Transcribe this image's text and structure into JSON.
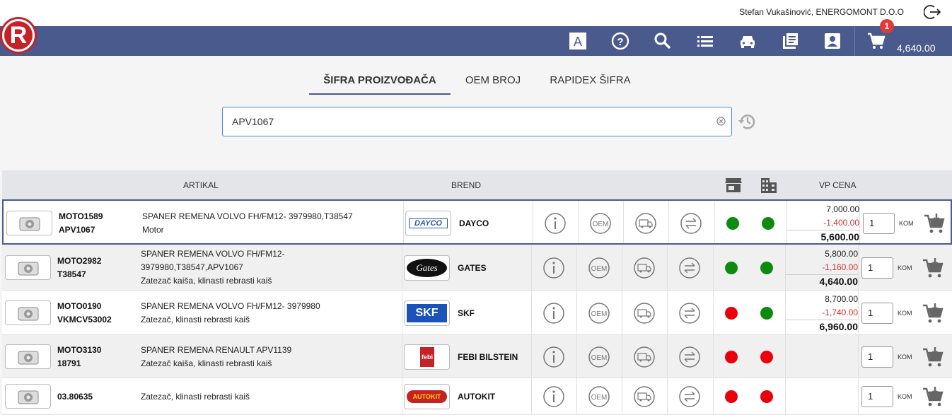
{
  "header": {
    "user": "Stefan Vukašinović, ENERGOMONT D.O.O",
    "cart_count": "1",
    "cart_total": "4,640.00",
    "logo_letter": "R"
  },
  "tabs": [
    "ŠIFRA PROIZVOĐAČA",
    "OEM BROJ",
    "RAPIDEX ŠIFRA"
  ],
  "search": {
    "value": "APV1067"
  },
  "columns": {
    "article": "ARTIKAL",
    "brand": "BREND",
    "price": "VP CENA"
  },
  "unit_label": "KOM",
  "rows": [
    {
      "code1": "MOTO1589",
      "code2": "APV1067",
      "desc1": "SPANER REMENA VOLVO FH/FM12- 3979980,T38547",
      "desc2": "Motor",
      "desc3": "",
      "brand": "DAYCO",
      "brand_logo": "DAYCO",
      "stock1": "green",
      "stock2": "green",
      "price": "7,000.00",
      "discount": "-1,400.00",
      "final": "5,600.00",
      "qty": "1"
    },
    {
      "code1": "MOTO2982",
      "code2": "T38547",
      "desc1": "SPANER REMENA VOLVO FH/FM12-",
      "desc2": "3979980,T38547,APV1067",
      "desc3": "Zatezač kaiša, klinasti rebrasti kaiš",
      "brand": "GATES",
      "brand_logo": "Gates",
      "stock1": "green",
      "stock2": "green",
      "price": "5,800.00",
      "discount": "-1,160.00",
      "final": "4,640.00",
      "qty": "1"
    },
    {
      "code1": "MOTO0190",
      "code2": "VKMCV53002",
      "desc1": "SPANER REMENA VOLVO FH/FM12- 3979980",
      "desc2": "Zatezač, klinasti rebrasti kaiš",
      "desc3": "",
      "brand": "SKF",
      "brand_logo": "SKF",
      "stock1": "red",
      "stock2": "green",
      "price": "8,700.00",
      "discount": "-1,740.00",
      "final": "6,960.00",
      "qty": "1"
    },
    {
      "code1": "MOTO3130",
      "code2": "18791",
      "desc1": "SPANER REMENA RENAULT APV1139",
      "desc2": "Zatezač kaiša, klinasti rebrasti kaiš",
      "desc3": "",
      "brand": "FEBI BILSTEIN",
      "brand_logo": "febi",
      "stock1": "red",
      "stock2": "red",
      "price": "",
      "discount": "",
      "final": "",
      "qty": "1"
    },
    {
      "code1": "03.80635",
      "code2": "",
      "desc1": "Zatezač, klinasti rebrasti kaiš",
      "desc2": "",
      "desc3": "",
      "brand": "AUTOKIT",
      "brand_logo": "AUTOKIT",
      "stock1": "red",
      "stock2": "red",
      "price": "",
      "discount": "",
      "final": "",
      "qty": "1"
    }
  ]
}
